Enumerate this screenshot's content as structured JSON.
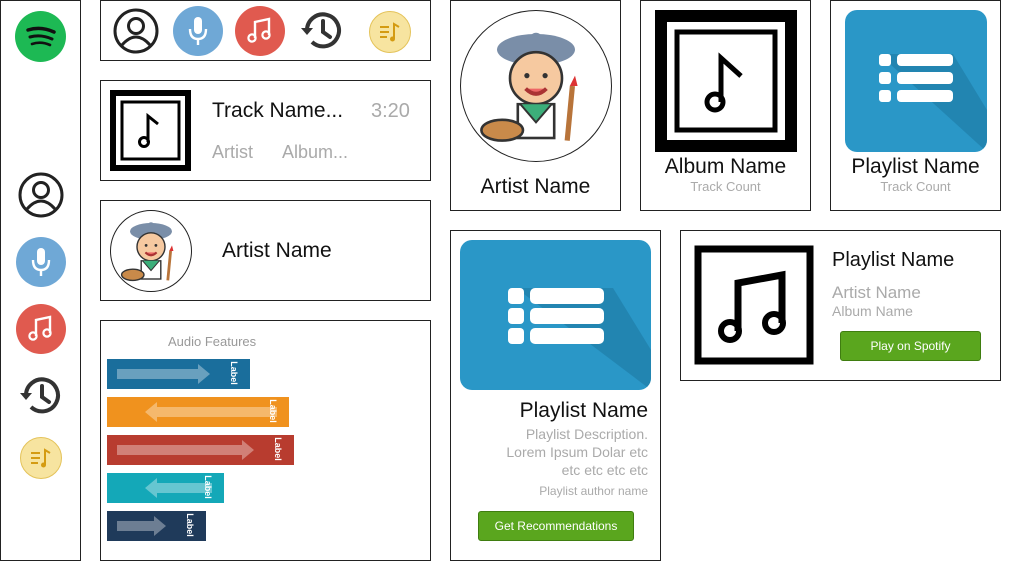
{
  "colors": {
    "spotify_green": "#1db954",
    "mic_blue": "#6fa8d6",
    "music_red": "#e05a4f",
    "playlist_blue": "#2a97c7",
    "queue_yellow": "#f7e4a0",
    "button_green": "#5aa61e"
  },
  "sidebar": {
    "icons": [
      "spotify-logo",
      "user-icon",
      "microphone-icon",
      "music-note-icon",
      "history-icon",
      "queue-icon"
    ]
  },
  "icon_bar": {
    "icons": [
      "user-icon",
      "microphone-icon",
      "music-note-icon",
      "history-icon",
      "queue-icon"
    ]
  },
  "track_card": {
    "name": "Track Name...",
    "duration": "3:20",
    "artist": "Artist",
    "album": "Album..."
  },
  "artist_row": {
    "name": "Artist Name"
  },
  "audio_features": {
    "title": "Audio Features"
  },
  "chart_data": {
    "type": "bar",
    "title": "Audio Features",
    "categories": [
      "Label",
      "Label",
      "Label",
      "Label",
      "Label"
    ],
    "series": [
      {
        "values": [
          0.55,
          0.7,
          0.72,
          0.45,
          0.38
        ]
      }
    ],
    "colors": [
      "#1a6e9c",
      "#f0921e",
      "#b83c2f",
      "#14a8b8",
      "#1f3a5a"
    ],
    "arrow_directions": [
      "right",
      "left",
      "right",
      "left",
      "right"
    ]
  },
  "artist_card": {
    "name": "Artist Name"
  },
  "album_card": {
    "name": "Album Name",
    "subtitle": "Track Count"
  },
  "playlist_card": {
    "name": "Playlist Name",
    "subtitle": "Track Count"
  },
  "playlist_detail": {
    "name": "Playlist Name",
    "description_line1": "Playlist Description.",
    "description_line2": "Lorem Ipsum Dolar etc",
    "description_line3": "etc etc etc etc",
    "author": "Playlist author name",
    "button": "Get Recommendations"
  },
  "playlist_player": {
    "name": "Playlist Name",
    "artist": "Artist Name",
    "album": "Album Name",
    "button": "Play on Spotify"
  }
}
